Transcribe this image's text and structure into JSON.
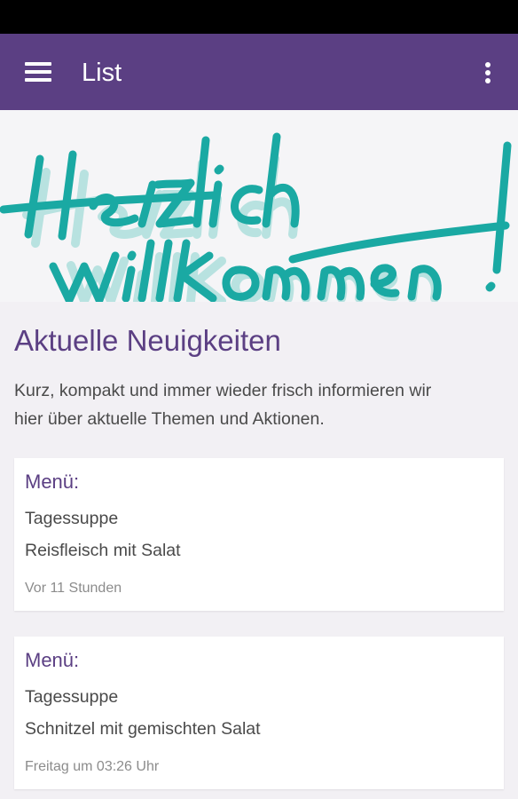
{
  "app_bar": {
    "title": "List",
    "menu_icon": "hamburger-menu-icon",
    "overflow_icon": "more-vertical-icon"
  },
  "banner": {
    "text_line1": "Herzlich",
    "text_line2": "Willkommen!",
    "color": "#1aa9a3",
    "shadow_color": "#b8e2e0"
  },
  "news": {
    "title": "Aktuelle Neuigkeiten",
    "intro_line1": "Kurz, kompakt und immer wieder frisch informieren wir",
    "intro_line2": "hier über aktuelle Themen und Aktionen.",
    "items": [
      {
        "title": "Menü:",
        "line1": "Tagessuppe",
        "line2": "Reisfleisch mit Salat",
        "time": "Vor 11 Stunden"
      },
      {
        "title": "Menü:",
        "line1": "Tagessuppe",
        "line2": "Schnitzel mit gemischten Salat",
        "time": "Freitag um 03:26 Uhr"
      }
    ]
  },
  "colors": {
    "accent": "#5b3f83",
    "text": "#4a4a4a",
    "muted": "#8c8c8c",
    "background": "#f2f0f4"
  }
}
